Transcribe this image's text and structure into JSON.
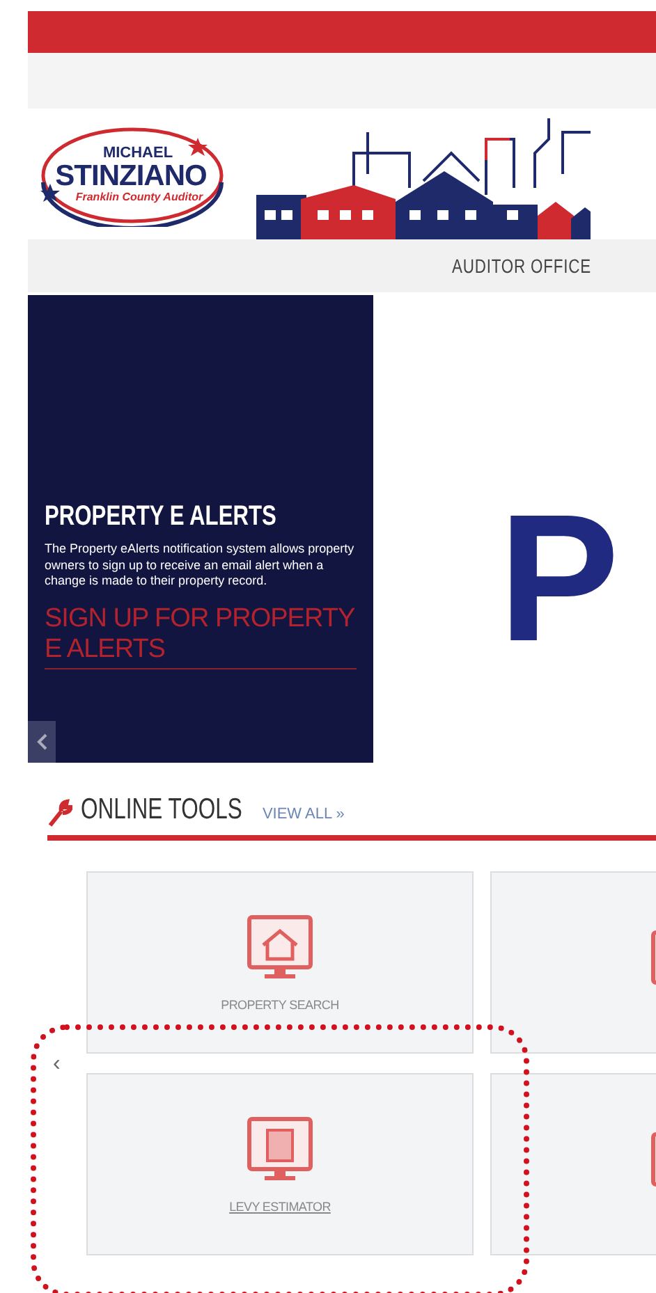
{
  "logo": {
    "first_name": "MICHAEL",
    "last_name": "STINZIANO",
    "subtitle": "Franklin County Auditor"
  },
  "nav": {
    "items": [
      {
        "label": "AUDITOR OFFICE",
        "selected": false
      }
    ]
  },
  "hero": {
    "panel": {
      "title": "PROPERTY E ALERTS",
      "text": "The Property eAlerts notification system allows property owners to sign up to receive an email alert when a change is made to their property record.",
      "link": "SIGN UP FOR PROPERTY E ALERTS"
    },
    "banner_text": "P"
  },
  "online_tools": {
    "title": "ONLINE TOOLS",
    "view_all": "VIEW ALL »",
    "previous": "‹",
    "cards": [
      {
        "kind": "house",
        "label": "PROPERTY SEARCH",
        "highlighted": false
      },
      {
        "kind": "monitor",
        "highlighted": false
      },
      {
        "kind": "calculator",
        "label": "LEVY ESTIMATOR",
        "highlighted": true
      },
      {
        "kind": "monitor",
        "highlighted": false
      }
    ]
  }
}
